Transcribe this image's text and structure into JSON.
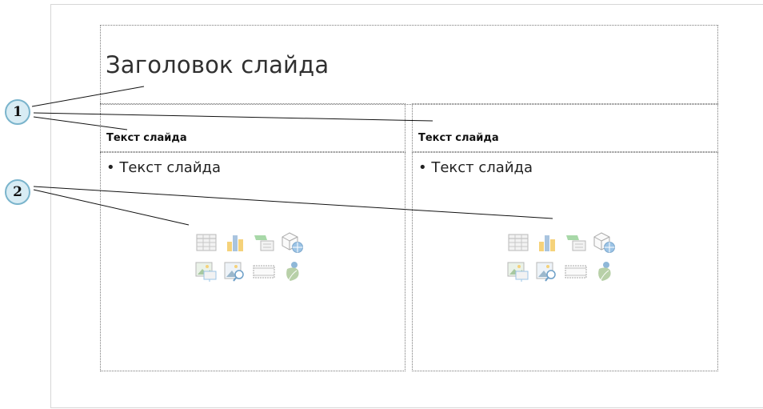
{
  "slide": {
    "title": "Заголовок слайда",
    "left_column": {
      "header": "Текст слайда",
      "bullet": "• Текст слайда"
    },
    "right_column": {
      "header": "Текст слайда",
      "bullet": "• Текст слайда"
    },
    "content_icons": [
      "insert-table-icon",
      "insert-chart-icon",
      "insert-smartart-icon",
      "insert-3d-model-icon",
      "insert-pictures-icon",
      "online-pictures-icon",
      "insert-video-icon",
      "insert-icons-icon"
    ]
  },
  "callouts": {
    "one": "1",
    "two": "2"
  },
  "colors": {
    "callout_fill": "#d8ecf4",
    "callout_border": "#7ab4cc",
    "placeholder_border": "#7a7a7a"
  }
}
